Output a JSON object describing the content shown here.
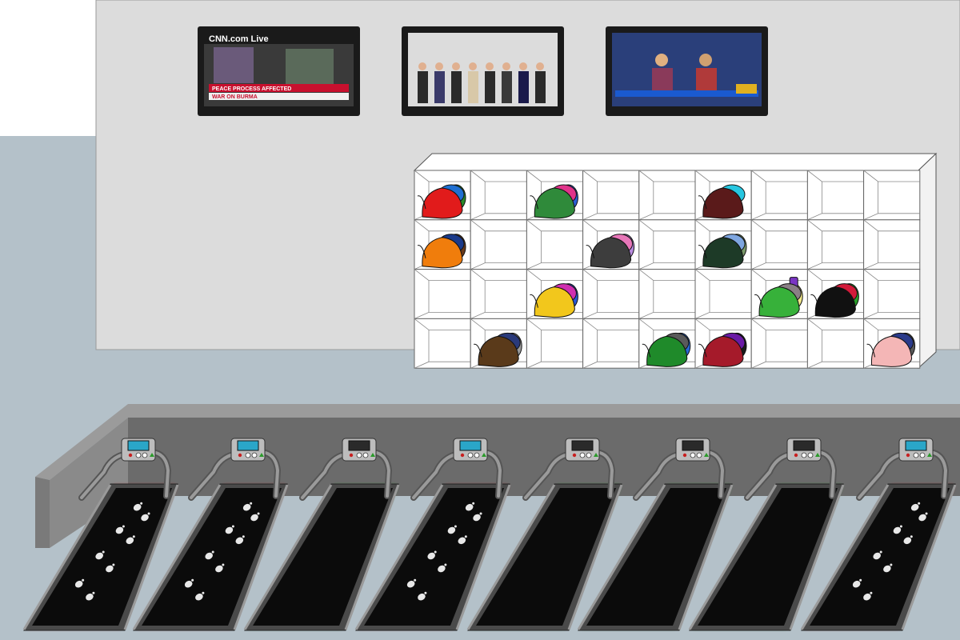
{
  "scene": {
    "description_colors": {
      "floor": "#b4c1c9",
      "back_wall": "#dcdcdc",
      "upper_left_wall": "#ffffff",
      "platform": "#6b6b6b",
      "platform_top": "#9b9b9b",
      "cubby_white": "#ffffff",
      "treadmill_belt": "#0b0b0b",
      "treadmill_frame": "#8a8a8a"
    }
  },
  "tvs": [
    {
      "channel_logo": "CNN.com Live",
      "headline": "PEACE PROCESS AFFECTED",
      "subhead": "WAR ON BURMA",
      "theme": "#c8102e"
    },
    {
      "channel_logo": "",
      "headline": "",
      "subhead": "",
      "theme": "#b5b5b5"
    },
    {
      "channel_logo": "",
      "headline": "",
      "subhead": "",
      "theme": "#1c3d8f"
    }
  ],
  "cubbies": {
    "rows": 4,
    "cols": 9,
    "bags": [
      {
        "row": 0,
        "col": 0,
        "colors": [
          "#e11b1b",
          "#1f6fd1",
          "#2a8a2a"
        ]
      },
      {
        "row": 0,
        "col": 2,
        "colors": [
          "#2f8a3a",
          "#e0338a",
          "#2a5fd4"
        ]
      },
      {
        "row": 0,
        "col": 5,
        "colors": [
          "#5a1a1a",
          "#27c6e0"
        ]
      },
      {
        "row": 1,
        "col": 0,
        "colors": [
          "#f07d0c",
          "#1b3a8a",
          "#6a3b1c"
        ]
      },
      {
        "row": 1,
        "col": 3,
        "colors": [
          "#3d3d3d",
          "#e877b9",
          "#b98ce0"
        ]
      },
      {
        "row": 1,
        "col": 5,
        "colors": [
          "#1d3a27",
          "#7ea6e0",
          "#7a9a6a"
        ]
      },
      {
        "row": 2,
        "col": 2,
        "colors": [
          "#f2c71c",
          "#d02fb0",
          "#2a59d6"
        ]
      },
      {
        "row": 2,
        "col": 6,
        "colors": [
          "#37b13a",
          "#8a7f85",
          "#f2e88a",
          "#7a35c4"
        ]
      },
      {
        "row": 2,
        "col": 7,
        "colors": [
          "#111111",
          "#d21a3a",
          "#2aa02a"
        ]
      },
      {
        "row": 3,
        "col": 1,
        "colors": [
          "#5a3a1a",
          "#2a3a7a",
          "#9a9a9a"
        ]
      },
      {
        "row": 3,
        "col": 4,
        "colors": [
          "#1f8a2a",
          "#5a5a5a",
          "#2a6ad4"
        ]
      },
      {
        "row": 3,
        "col": 5,
        "colors": [
          "#a51a2a",
          "#6a1aa5",
          "#1a1a1a"
        ]
      },
      {
        "row": 3,
        "col": 8,
        "colors": [
          "#f4b6b6",
          "#2a3a8a",
          "#5a5a5a"
        ]
      }
    ]
  },
  "treadmills": [
    {
      "glow": "#cc2a2a",
      "footprints": true,
      "screen_on": true
    },
    {
      "glow": "#cc2a2a",
      "footprints": true,
      "screen_on": true
    },
    {
      "glow": "#2a9a2a",
      "footprints": false,
      "screen_on": false
    },
    {
      "glow": "#cc2a2a",
      "footprints": true,
      "screen_on": true
    },
    {
      "glow": "#2a9a2a",
      "footprints": false,
      "screen_on": false
    },
    {
      "glow": "#2a9a2a",
      "footprints": false,
      "screen_on": false
    },
    {
      "glow": "#2a9a2a",
      "footprints": false,
      "screen_on": false
    },
    {
      "glow": "#cc2a2a",
      "footprints": true,
      "screen_on": true
    }
  ]
}
